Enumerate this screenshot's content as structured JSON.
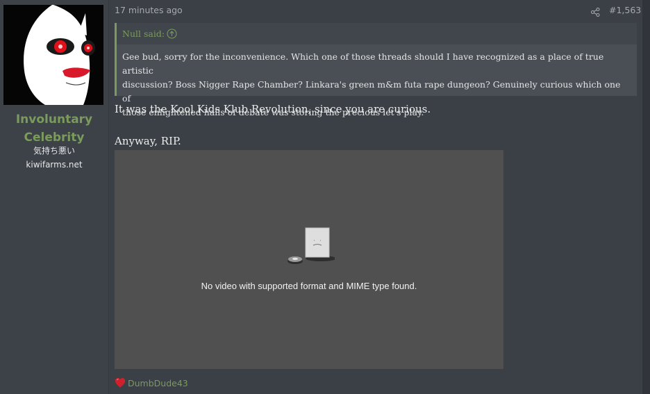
{
  "user": {
    "name_line1": "Involuntary",
    "name_line2": "Celebrity",
    "title_line1": "気持ち悪い",
    "title_line2": "kiwifarms.net",
    "name_color": "#7a9b5c"
  },
  "post": {
    "time": "17 minutes ago",
    "number": "#1,563",
    "quote": {
      "author": "Null said:",
      "line1": "Gee bud, sorry for the inconvenience. Which one of those threads should I have recognized as a place of true artistic",
      "line2": "discussion? Boss Nigger Rape Chamber? Linkara's green m&m futa rape dungeon? Genuinely curious which one of",
      "line3": "those enlightened halls of debate was storing the precious let's play."
    },
    "body_line1": "It was the Kool Kids Klub Revolution, since you are curious.",
    "body_line2": "Anyway, RIP.",
    "video_message": "No video with supported format and MIME type found.",
    "reaction_user": "DumbDude43"
  },
  "icons": {
    "share": "share-icon",
    "quote_jump": "arrow-up-circle-icon",
    "plugin": "missing-plugin-icon",
    "reaction": "heart-icon"
  }
}
